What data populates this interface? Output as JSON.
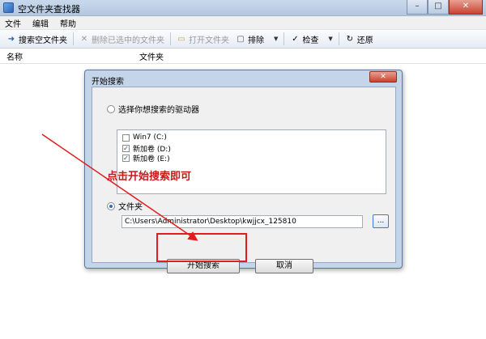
{
  "window": {
    "title": "空文件夹查找器",
    "controls": {
      "minimize": "–",
      "maximize": "□",
      "close": "✕"
    }
  },
  "menu": [
    "文件",
    "编辑",
    "帮助"
  ],
  "toolbar": {
    "search": "搜索空文件夹",
    "delete": "删除已选中的文件夹",
    "open": "打开文件夹",
    "exclude": "排除",
    "check": "检查",
    "restore": "还原"
  },
  "list_header": {
    "name": "名称",
    "folder": "文件夹"
  },
  "dialog": {
    "title": "开始搜索",
    "close": "✕",
    "option_drives": "选择你想搜索的驱动器",
    "drives": [
      {
        "label": "Win7 (C:)",
        "checked": false
      },
      {
        "label": "新加卷 (D:)",
        "checked": true
      },
      {
        "label": "新加卷 (E:)",
        "checked": true
      }
    ],
    "option_folder": "文件夹",
    "path": "C:\\Users\\Administrator\\Desktop\\kwjjcx_125810",
    "browse": "...",
    "start_button": "开始搜索",
    "cancel_button": "取消"
  },
  "annotation": {
    "text": "点击开始搜索即可",
    "color": "#c8191a"
  },
  "colors": {
    "accent": "#2d6fc4",
    "dialog_frame": "#c4d5ea",
    "highlight": "#e01e1e"
  }
}
